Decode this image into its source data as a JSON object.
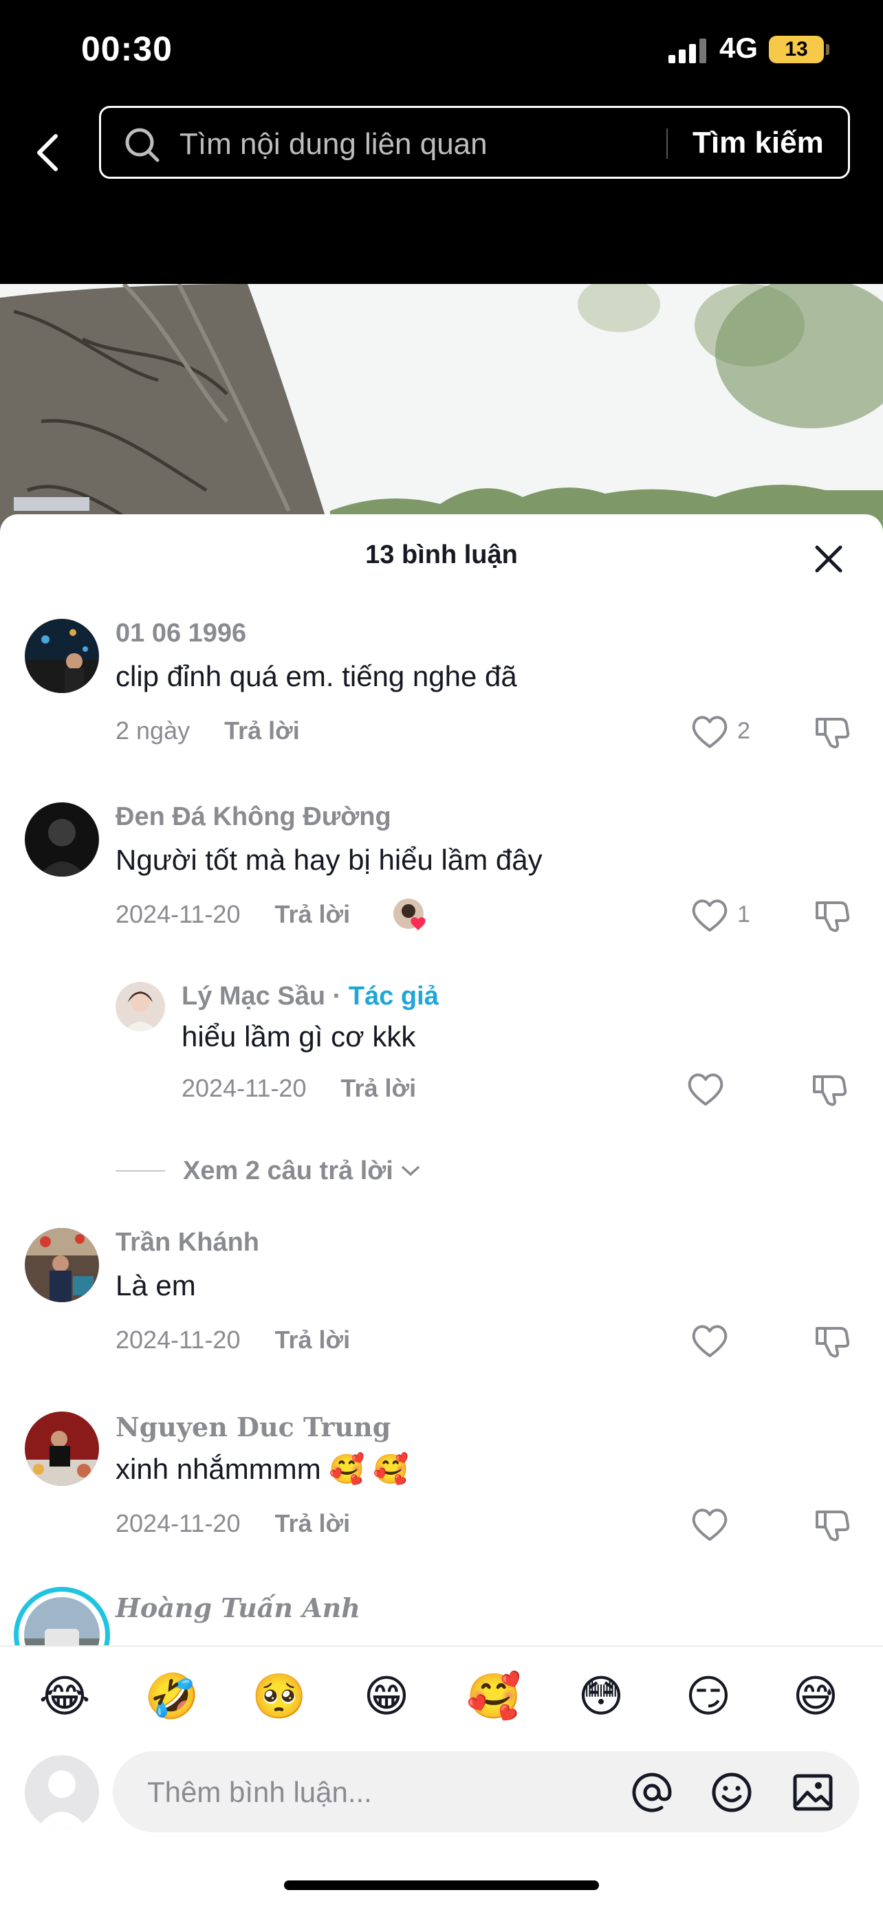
{
  "status_bar": {
    "time": "00:30",
    "network": "4G",
    "battery": "13"
  },
  "search": {
    "placeholder": "Tìm nội dung liên quan",
    "button": "Tìm kiếm"
  },
  "comments_panel": {
    "title": "13 bình luận"
  },
  "comments": [
    {
      "username": "01 06 1996",
      "text": "clip đỉnh quá em. tiếng nghe đã",
      "time": "2 ngày",
      "reply_label": "Trả lời",
      "likes": "2"
    },
    {
      "username": "Đen Đá Không Đường",
      "text": "Người tốt mà hay bị hiểu lầm đây",
      "time": "2024-11-20",
      "reply_label": "Trả lời",
      "likes": "1"
    },
    {
      "username": "Trần Khánh",
      "text": "Là em",
      "time": "2024-11-20",
      "reply_label": "Trả lời",
      "likes": ""
    },
    {
      "username": "Nguyen Duc Trung",
      "text": "xinh nhắmmmm 🥰 🥰",
      "time": "2024-11-20",
      "reply_label": "Trả lời",
      "likes": ""
    },
    {
      "username": "Hoàng Tuấn Anh"
    }
  ],
  "reply": {
    "username": "Lý Mạc Sầu",
    "author_badge": "Tác giả",
    "text": "hiểu lầm gì cơ kkk",
    "time": "2024-11-20",
    "reply_label": "Trả lời"
  },
  "view_more_replies": "Xem 2 câu trả lời",
  "emoji_bar": [
    "😂",
    "🤣",
    "🥺",
    "😁",
    "🥰",
    "😳",
    "😏",
    "😅"
  ],
  "comment_input": {
    "placeholder": "Thêm bình luận..."
  },
  "icons": [
    "back-icon",
    "search-icon",
    "close-icon",
    "heart-icon",
    "dislike-icon",
    "at-icon",
    "emoji-icon",
    "image-icon",
    "chevron-down-icon"
  ]
}
